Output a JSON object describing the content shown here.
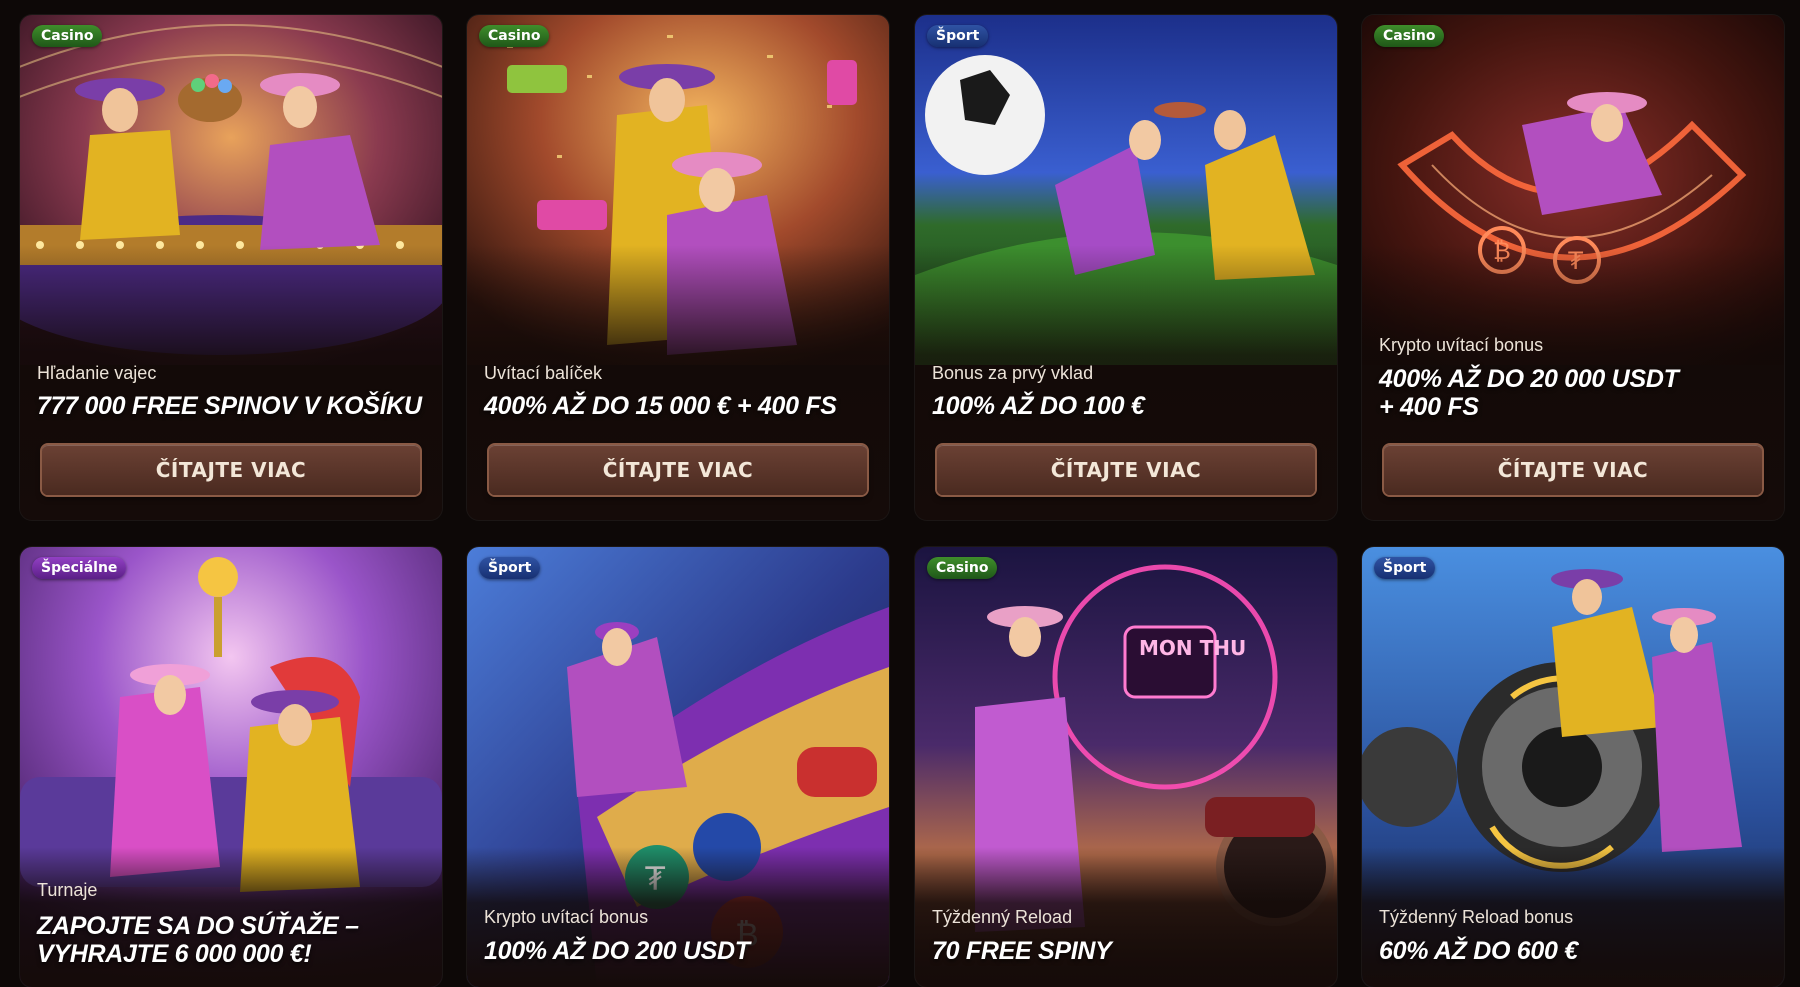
{
  "cards": [
    {
      "badge": "Casino",
      "subtitle": "Hľadanie vajec",
      "headline": "777 000 FREE SPINOV V KOŠÍKU",
      "button": "ČÍTAJTE VIAC"
    },
    {
      "badge": "Casino",
      "subtitle": "Uvítací balíček",
      "headline": "400% AŽ DO 15 000 € + 400 FS",
      "button": "ČÍTAJTE VIAC"
    },
    {
      "badge": "Šport",
      "subtitle": "Bonus za prvý vklad",
      "headline": "100% AŽ DO 100 €",
      "button": "ČÍTAJTE VIAC"
    },
    {
      "badge": "Casino",
      "subtitle": "Krypto uvítací bonus",
      "headline_line1": "400% AŽ DO 20 000 USDT",
      "headline_line2": "+ 400 FS",
      "button": "ČÍTAJTE VIAC"
    },
    {
      "badge": "Špeciálne",
      "subtitle": "Turnaje",
      "headline_line1": "ZAPOJTE SA DO SÚŤAŽE –",
      "headline_line2": "VYHRAJTE 6 000 000 €!"
    },
    {
      "badge": "Šport",
      "subtitle": "Krypto uvítací bonus",
      "headline": "100% AŽ DO 200 USDT"
    },
    {
      "badge": "Casino",
      "subtitle": "Týždenný Reload",
      "headline": "70 FREE SPINY",
      "neon_sign": "MON THU"
    },
    {
      "badge": "Šport",
      "subtitle": "Týždenný Reload bonus",
      "headline": "60% AŽ DO 600 €"
    }
  ]
}
